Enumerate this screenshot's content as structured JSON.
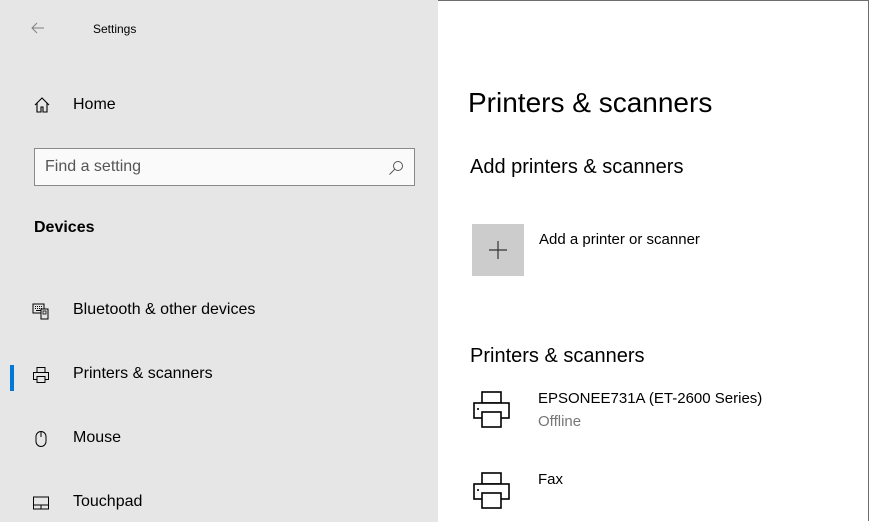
{
  "window": {
    "title": "Settings"
  },
  "sidebar": {
    "home_label": "Home",
    "search": {
      "placeholder": "Find a setting",
      "value": ""
    },
    "section_header": "Devices",
    "items": [
      {
        "label": "Bluetooth & other devices",
        "icon": "keyboard-devices-icon",
        "selected": false
      },
      {
        "label": "Printers & scanners",
        "icon": "printer-icon",
        "selected": true
      },
      {
        "label": "Mouse",
        "icon": "mouse-icon",
        "selected": false
      },
      {
        "label": "Touchpad",
        "icon": "touchpad-icon",
        "selected": false
      }
    ]
  },
  "main": {
    "page_title": "Printers & scanners",
    "add_section_title": "Add printers & scanners",
    "add_button_label": "Add a printer or scanner",
    "list_section_title": "Printers & scanners",
    "printers": [
      {
        "name": "EPSONEE731A (ET-2600 Series)",
        "status": "Offline"
      },
      {
        "name": "Fax",
        "status": ""
      }
    ]
  },
  "colors": {
    "accent": "#0078d7",
    "sidebar_bg": "#e6e6e6",
    "tile_bg": "#cccccc",
    "status_text": "#767676"
  }
}
